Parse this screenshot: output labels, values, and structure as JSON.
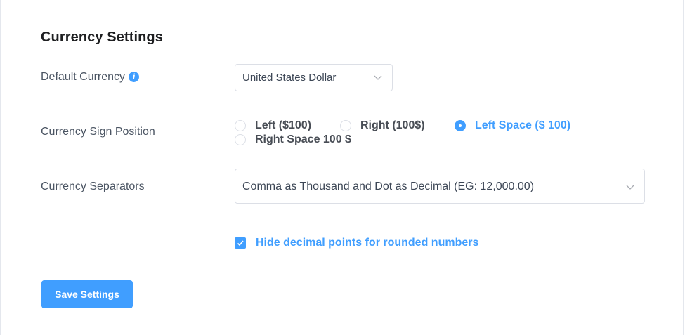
{
  "section": {
    "title": "Currency Settings"
  },
  "default_currency": {
    "label": "Default Currency",
    "info_icon": "info-icon",
    "value": "United States Dollar"
  },
  "sign_position": {
    "label": "Currency Sign Position",
    "options": [
      {
        "label": "Left ($100)",
        "checked": false
      },
      {
        "label": "Right (100$)",
        "checked": false
      },
      {
        "label": "Left Space ($ 100)",
        "checked": true
      },
      {
        "label": "Right Space 100 $",
        "checked": false
      }
    ]
  },
  "separators": {
    "label": "Currency Separators",
    "value": "Comma as Thousand and Dot as Decimal (EG: 12,000.00)"
  },
  "hide_decimal": {
    "label": "Hide decimal points for rounded numbers",
    "checked": true
  },
  "actions": {
    "save_label": "Save Settings"
  },
  "colors": {
    "accent": "#409eff",
    "border": "#dcdfe6",
    "label_text": "#4b5563",
    "title_text": "#1e1f21"
  }
}
